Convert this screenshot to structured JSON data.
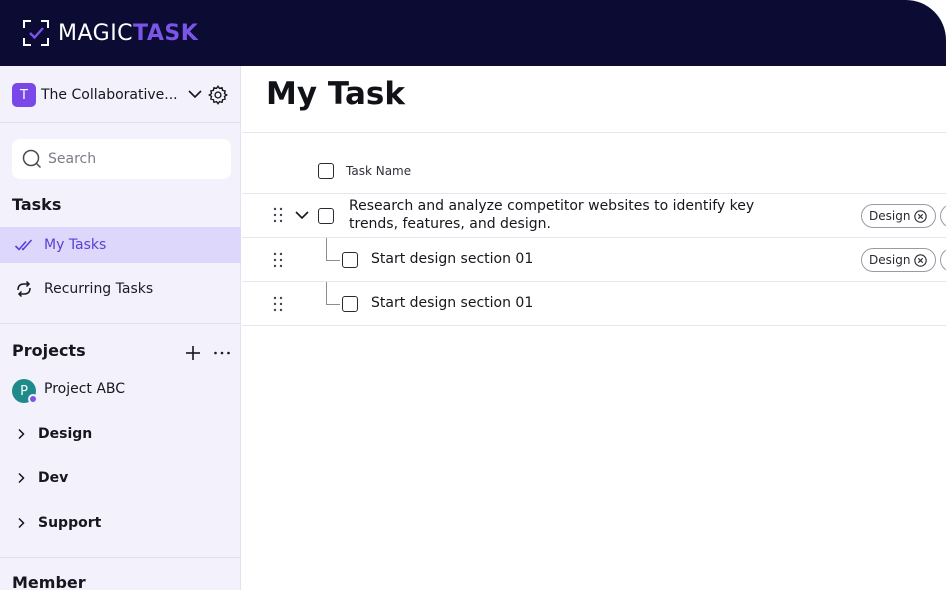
{
  "brand": {
    "name_prefix": "MAGIC",
    "name_accent": "TASK",
    "accent_color": "#7a55e8",
    "bar_color": "#0b0b33"
  },
  "workspace": {
    "initial": "T",
    "name": "The Collaborative..."
  },
  "search": {
    "placeholder": "Search"
  },
  "sidebar": {
    "tasks_title": "Tasks",
    "nav": [
      {
        "label": "My Tasks",
        "icon": "double-check-icon",
        "active": true
      },
      {
        "label": "Recurring Tasks",
        "icon": "repeat-icon",
        "active": false
      }
    ],
    "projects_title": "Projects",
    "project": {
      "initial": "P",
      "name": "Project ABC"
    },
    "folders": [
      {
        "label": "Design"
      },
      {
        "label": "Dev"
      },
      {
        "label": "Support"
      }
    ],
    "member_title": "Member"
  },
  "main": {
    "title": "My Task",
    "column_header": "Task Name",
    "tasks": [
      {
        "text_line1": "Research and analyze competitor websites to identify key",
        "text_line2": "trends, features, and design.",
        "tag": "Design"
      },
      {
        "text": "Start design section 01",
        "tag": "Design"
      },
      {
        "text": "Start design section 01"
      }
    ]
  }
}
